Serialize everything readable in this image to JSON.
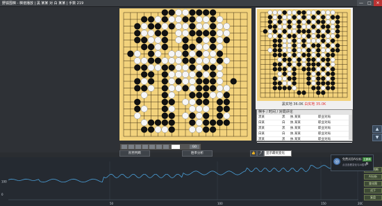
{
  "window": {
    "title": "野狐围棋 - 棋谱播放 | 黑 某某 对 白 某某 | 手数 219",
    "minimize": "—",
    "maximize": "□",
    "close": "✕"
  },
  "boards": {
    "left_label": "",
    "right_status": "黑实地 36.0K",
    "right_status_red": "白实地 35.0K"
  },
  "comment_panel": {
    "header": "棋手 / 时间 / 对局评论",
    "rows": [
      {
        "name": "黑某",
        "col": "黑",
        "detail": "执 某某",
        "type": "职业对局"
      },
      {
        "name": "白某",
        "col": "白",
        "detail": "执 某某",
        "type": "职业对局"
      },
      {
        "name": "黑某",
        "col": "黑",
        "detail": "执 某某",
        "type": "职业对局"
      },
      {
        "name": "白某",
        "col": "白",
        "detail": "执 某某",
        "type": "职业对局"
      },
      {
        "name": "黑某",
        "col": "黑",
        "detail": "执 某某",
        "type": "职业对局"
      }
    ]
  },
  "controls": {
    "nav_go": "GO",
    "btn_left": "形势判断",
    "btn_right": "胜率分析",
    "select_value": "显示最优变化"
  },
  "popup": {
    "title": "免费试用AI分析",
    "sub": "点击查看变化与AI胜率",
    "action": "立即体验"
  },
  "graph": {
    "y_labels": [
      "100",
      "0"
    ],
    "x_labels": [
      "50",
      "100",
      "150",
      "200"
    ],
    "color": "#4a9fd8"
  },
  "tools": [
    "形势判断",
    "AI分析",
    "变化图",
    "试下",
    "复盘"
  ]
}
